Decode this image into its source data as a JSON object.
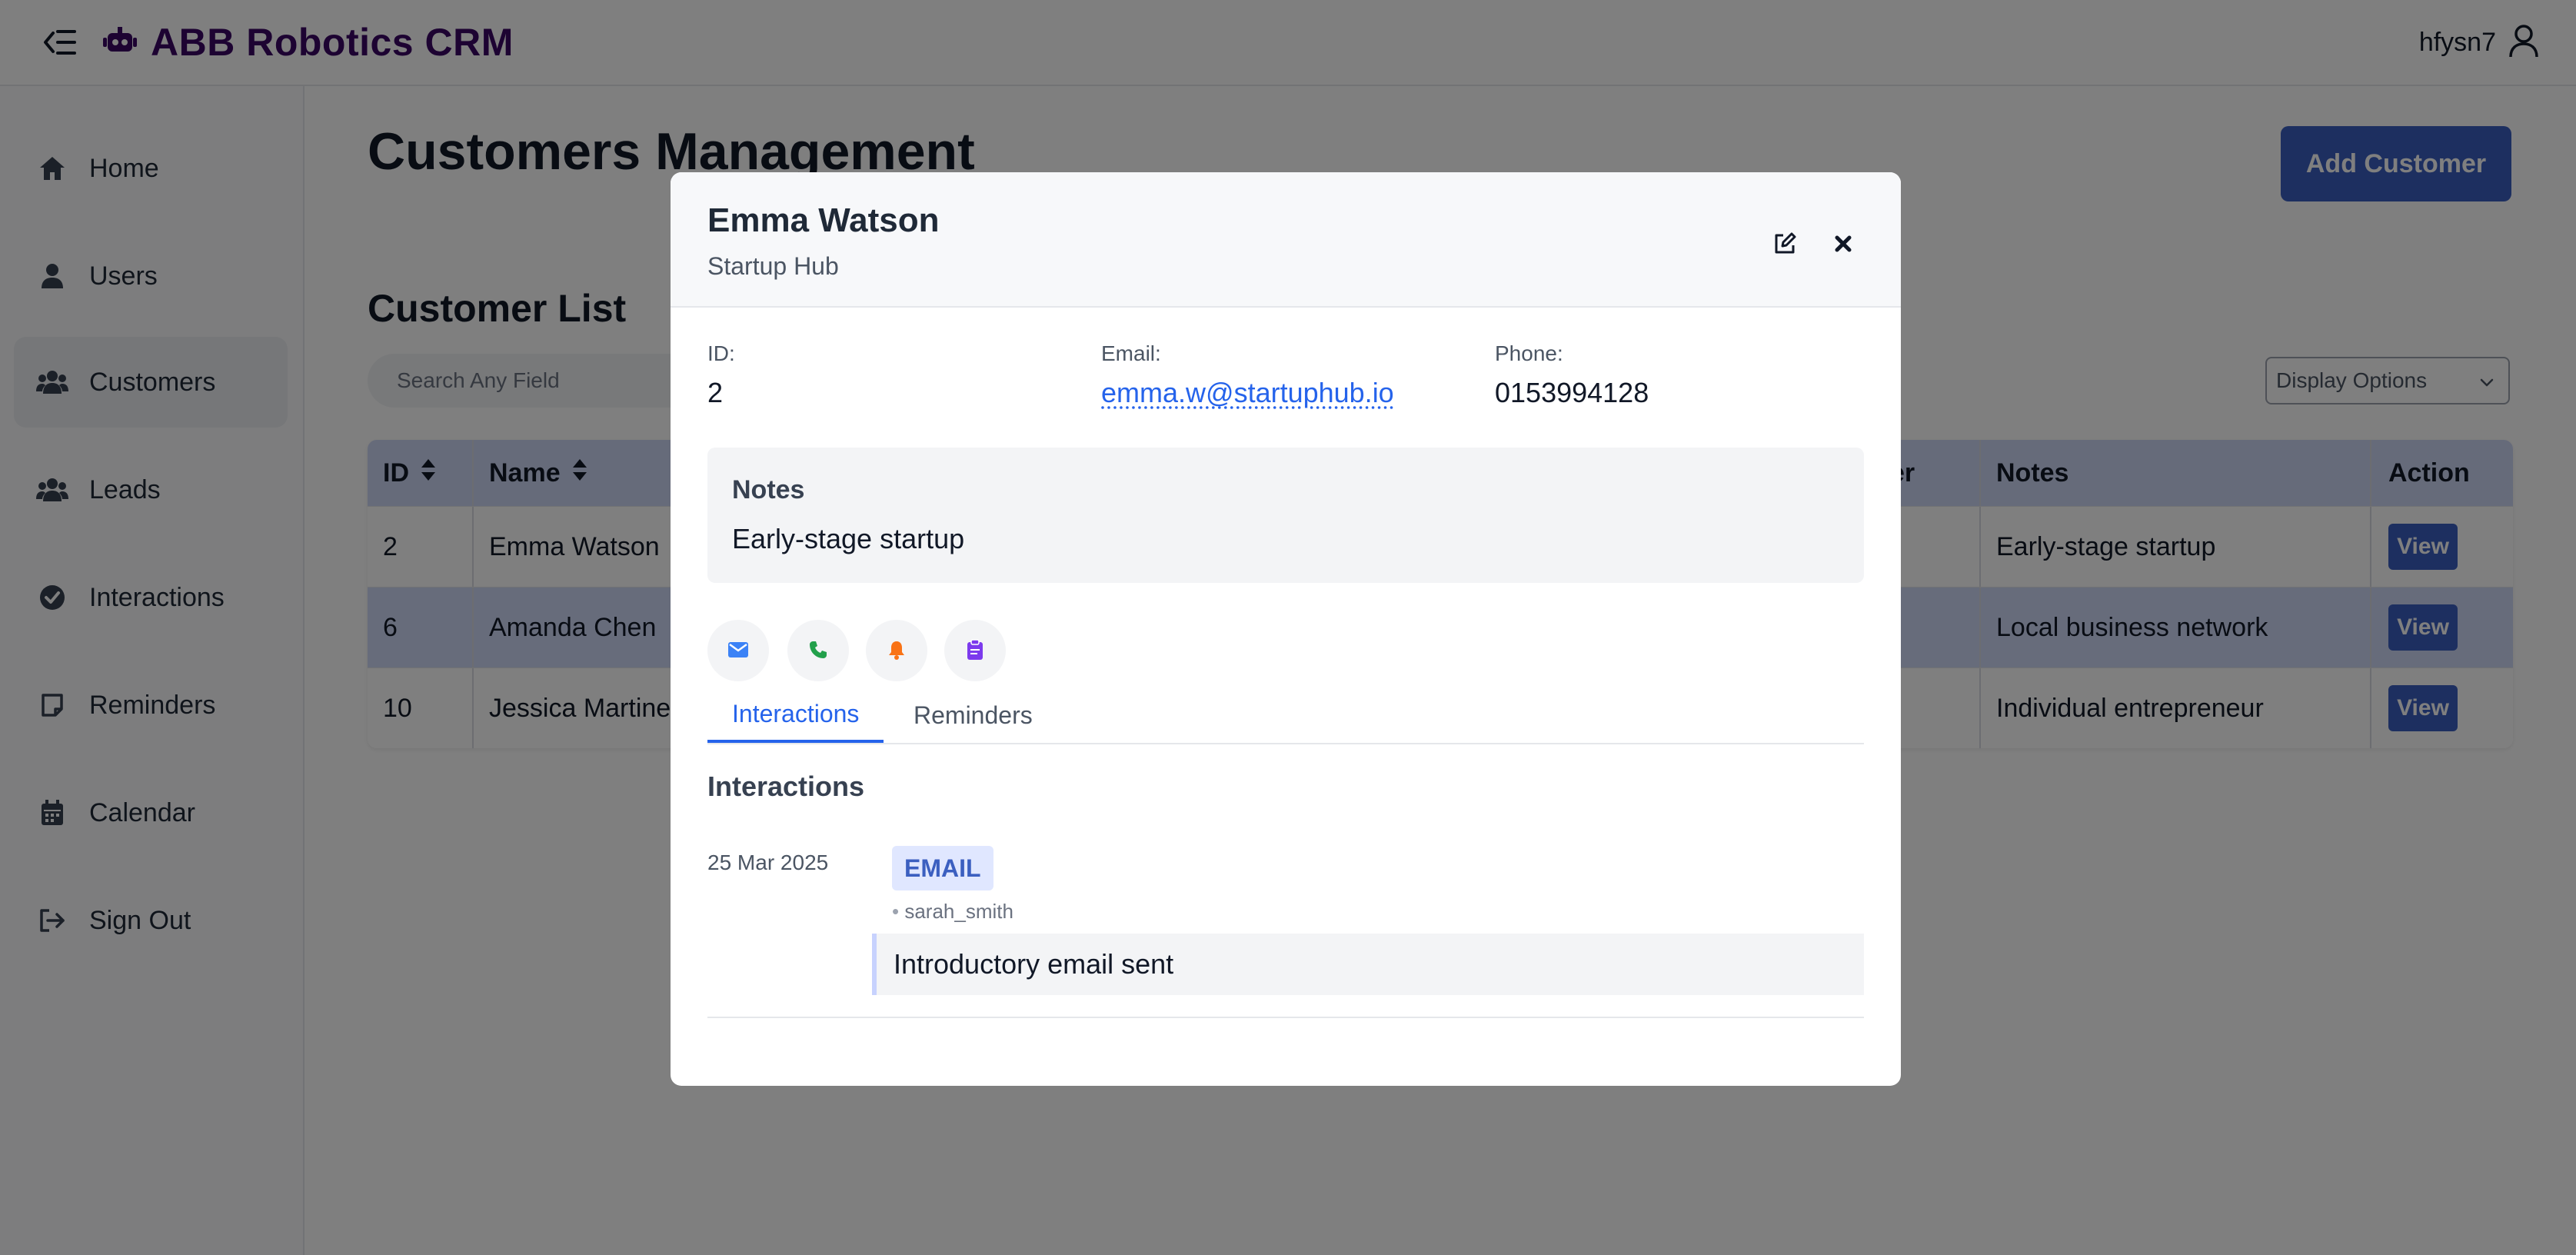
{
  "app": {
    "title": "ABB Robotics CRM",
    "user": "hfysn7"
  },
  "sidebar": {
    "items": [
      {
        "label": "Home",
        "icon": "home-icon"
      },
      {
        "label": "Users",
        "icon": "user-icon"
      },
      {
        "label": "Customers",
        "icon": "users-group-icon",
        "active": true
      },
      {
        "label": "Leads",
        "icon": "users-group-icon"
      },
      {
        "label": "Interactions",
        "icon": "check-circle-icon"
      },
      {
        "label": "Reminders",
        "icon": "note-icon"
      },
      {
        "label": "Calendar",
        "icon": "calendar-icon"
      },
      {
        "label": "Sign Out",
        "icon": "sign-out-icon"
      }
    ]
  },
  "page": {
    "title": "Customers Management",
    "add_button": "Add Customer",
    "list_title": "Customer List",
    "search_placeholder": "Search Any Field",
    "display_options": "Display Options"
  },
  "table": {
    "headers": {
      "id": "ID",
      "name": "Name",
      "partial": "er",
      "notes": "Notes",
      "action": "Action"
    },
    "rows": [
      {
        "id": "2",
        "name": "Emma Watson",
        "notes": "Early-stage startup",
        "action": "View"
      },
      {
        "id": "6",
        "name": "Amanda Chen",
        "notes": "Local business network",
        "action": "View"
      },
      {
        "id": "10",
        "name": "Jessica Martine",
        "notes": "Individual entrepreneur",
        "action": "View"
      }
    ]
  },
  "modal": {
    "name": "Emma Watson",
    "company": "Startup Hub",
    "fields": {
      "id_label": "ID:",
      "id_value": "2",
      "email_label": "Email:",
      "email_value": "emma.w@startuphub.io",
      "phone_label": "Phone:",
      "phone_value": "0153994128"
    },
    "notes": {
      "title": "Notes",
      "text": "Early-stage startup"
    },
    "tabs": [
      "Interactions",
      "Reminders"
    ],
    "section_title": "Interactions",
    "interaction": {
      "date": "25 Mar 2025",
      "type": "EMAIL",
      "user": "sarah_smith",
      "message": "Introductory email sent"
    }
  },
  "colors": {
    "brand": "#3b0764",
    "accent": "#3b5fc0",
    "link": "#2563eb",
    "row_highlight": "#cfd8f6"
  }
}
